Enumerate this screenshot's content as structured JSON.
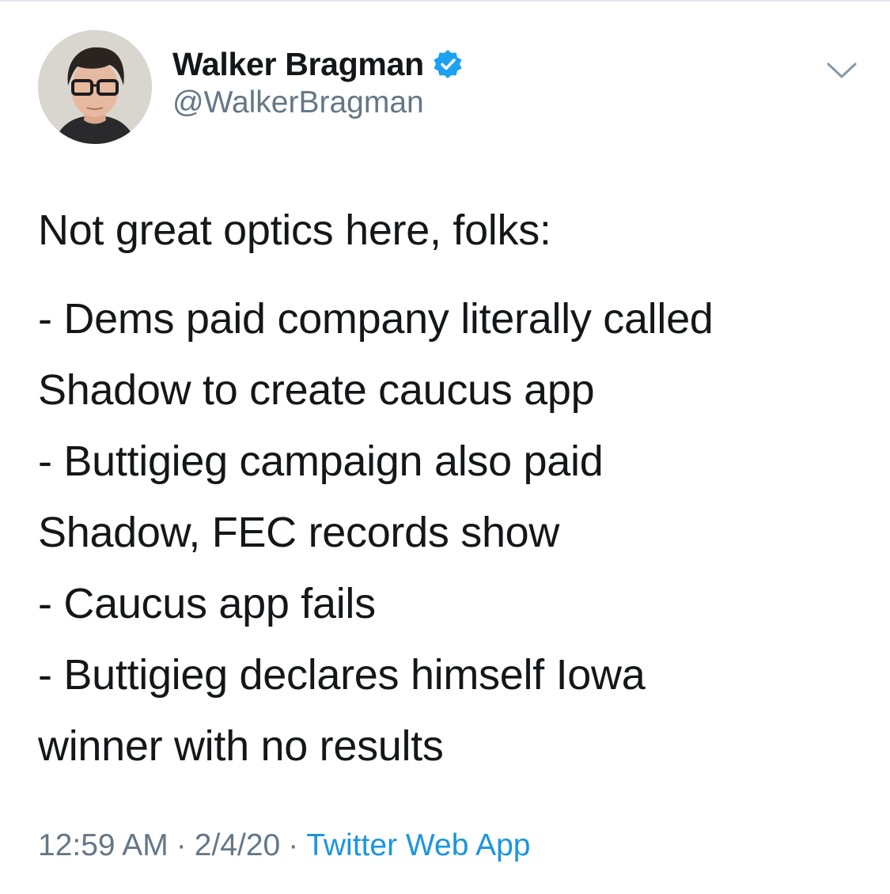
{
  "tweet": {
    "author": {
      "display_name": "Walker Bragman",
      "handle": "@WalkerBragman",
      "verified": true
    },
    "body_lines": [
      "Not great optics here, folks:",
      "- Dems paid company literally called",
      "Shadow to create caucus app",
      "- Buttigieg campaign also paid",
      "Shadow, FEC records show",
      "- Caucus app fails",
      "- Buttigieg declares himself Iowa",
      "winner with no results"
    ],
    "time": "12:59 AM",
    "date": "2/4/20",
    "separator": "·",
    "source": "Twitter Web App"
  },
  "icons": {
    "verified": "verified-badge-icon",
    "caret": "chevron-down-icon"
  },
  "colors": {
    "text": "#14171a",
    "secondary": "#657786",
    "accent": "#1b95e0",
    "verified": "#1da1f2"
  }
}
